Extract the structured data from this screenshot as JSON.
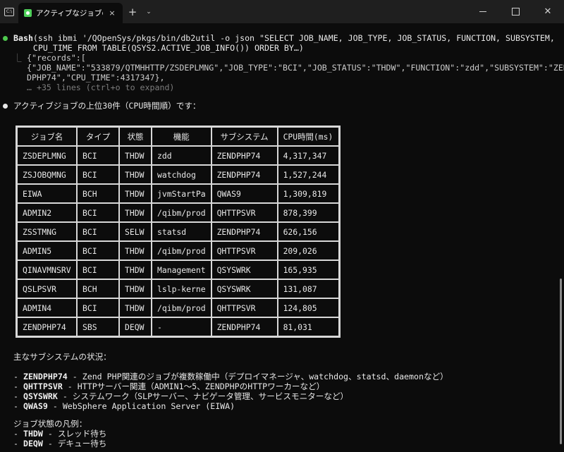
{
  "window": {
    "app_icon_text": "C:\\",
    "tab_title": "アクティブなジョブの状況",
    "tab_close": "×",
    "new_tab": "+",
    "dropdown": "⌄",
    "minimize": "",
    "maximize": "",
    "close": "✕"
  },
  "bash": {
    "label": "Bash",
    "command_line1": "(ssh ibmi '/QOpenSys/pkgs/bin/db2util -o json \"SELECT JOB_NAME, JOB_TYPE, JOB_STATUS, FUNCTION, SUBSYSTEM,",
    "command_line2": "    CPU_TIME FROM TABLE(QSYS2.ACTIVE_JOB_INFO()) ORDER BY…)",
    "output_line1": "{\"records\":[",
    "output_line2": "{\"JOB_NAME\":\"533879/QTMHHTTP/ZSDEPLMNG\",\"JOB_TYPE\":\"BCI\",\"JOB_STATUS\":\"THDW\",\"FUNCTION\":\"zdd\",\"SUBSYSTEM\":\"ZEN",
    "output_line3": "DPHP74\",\"CPU_TIME\":4317347},",
    "output_more": "… +35 lines (ctrl+o to expand)"
  },
  "message": {
    "intro": "アクティブジョブの上位30件（CPU時間順）です："
  },
  "table": {
    "headers": [
      "ジョブ名",
      "タイプ",
      "状態",
      "機能",
      "サブシステム",
      "CPU時間(ms)"
    ],
    "rows": [
      [
        "ZSDEPLMNG",
        "BCI",
        "THDW",
        "zdd",
        "ZENDPHP74",
        "4,317,347"
      ],
      [
        "ZSJOBQMNG",
        "BCI",
        "THDW",
        "watchdog",
        "ZENDPHP74",
        "1,527,244"
      ],
      [
        "EIWA",
        "BCH",
        "THDW",
        "jvmStartPa",
        "QWAS9",
        "1,309,819"
      ],
      [
        "ADMIN2",
        "BCI",
        "THDW",
        "/qibm/prod",
        "QHTTPSVR",
        "878,399"
      ],
      [
        "ZSSTMNG",
        "BCI",
        "SELW",
        "statsd",
        "ZENDPHP74",
        "626,156"
      ],
      [
        "ADMIN5",
        "BCI",
        "THDW",
        "/qibm/prod",
        "QHTTPSVR",
        "209,026"
      ],
      [
        "QINAVMNSRV",
        "BCI",
        "THDW",
        "Management",
        "QSYSWRK",
        "165,935"
      ],
      [
        "QSLPSVR",
        "BCH",
        "THDW",
        "lslp-kerne",
        "QSYSWRK",
        "131,087"
      ],
      [
        "ADMIN4",
        "BCI",
        "THDW",
        "/qibm/prod",
        "QHTTPSVR",
        "124,805"
      ],
      [
        "ZENDPHP74",
        "SBS",
        "DEQW",
        "-",
        "ZENDPHP74",
        "81,031"
      ]
    ]
  },
  "subsystems": {
    "heading": "主なサブシステムの状況：",
    "items": [
      {
        "name": "ZENDPHP74",
        "desc": " - Zend PHP関連のジョブが複数稼働中（デプロイマネージャ、watchdog、statsd、daemonなど）"
      },
      {
        "name": "QHTTPSVR",
        "desc": " - HTTPサーバー関連（ADMIN1〜5、ZENDPHPのHTTPワーカーなど）"
      },
      {
        "name": "QSYSWRK",
        "desc": " - システムワーク（SLPサーバー、ナビゲータ管理、サービスモニターなど）"
      },
      {
        "name": "QWAS9",
        "desc": " - WebSphere Application Server (EIWA)"
      }
    ]
  },
  "legend": {
    "heading": "ジョブ状態の凡例：",
    "items": [
      {
        "name": "THDW",
        "desc": " - スレッド待ち"
      },
      {
        "name": "DEQW",
        "desc": " - デキュー待ち"
      }
    ]
  },
  "colors": {
    "background": "#0c0c0c",
    "bullet_ok": "#4ec94e",
    "text": "#cccccc"
  }
}
